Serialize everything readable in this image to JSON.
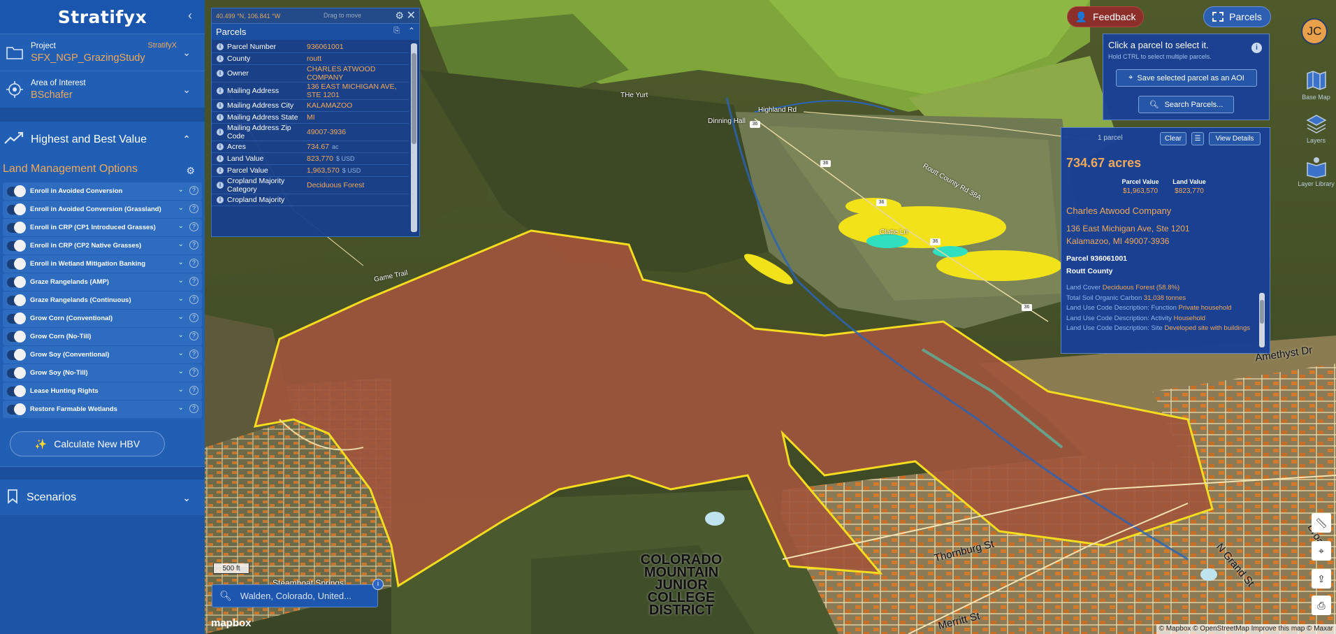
{
  "app": {
    "logo": "Stratifyx"
  },
  "project": {
    "label": "Project",
    "value": "SFX_NGP_GrazingStudy",
    "org": "StratifyX"
  },
  "aoi": {
    "label": "Area of Interest",
    "value": "BSchafer"
  },
  "hbv": {
    "title": "Highest and Best Value",
    "subtitle": "Land Management Options",
    "options": [
      "Enroll in Avoided Conversion",
      "Enroll in Avoided Conversion (Grassland)",
      "Enroll in CRP (CP1 Introduced Grasses)",
      "Enroll in CRP (CP2 Native Grasses)",
      "Enroll in Wetland Mitigation Banking",
      "Graze Rangelands (AMP)",
      "Graze Rangelands (Continuous)",
      "Grow Corn (Conventional)",
      "Grow Corn (No-Till)",
      "Grow Soy (Conventional)",
      "Grow Soy (No-Till)",
      "Lease Hunting Rights",
      "Restore Farmable Wetlands"
    ],
    "calc_label": "Calculate New HBV"
  },
  "scenarios": {
    "label": "Scenarios"
  },
  "parcel_panel": {
    "coords": "40.499 °N, 106.841 °W",
    "drag": "Drag to move",
    "title": "Parcels",
    "rows": [
      {
        "k": "Parcel Number",
        "v": "936061001",
        "u": ""
      },
      {
        "k": "County",
        "v": "routt",
        "u": ""
      },
      {
        "k": "Owner",
        "v": "CHARLES ATWOOD COMPANY",
        "u": ""
      },
      {
        "k": "Mailing Address",
        "v": "136 EAST MICHIGAN AVE, STE 1201",
        "u": ""
      },
      {
        "k": "Mailing Address City",
        "v": "KALAMAZOO",
        "u": ""
      },
      {
        "k": "Mailing Address State",
        "v": "MI",
        "u": ""
      },
      {
        "k": "Mailing Address Zip Code",
        "v": "49007-3936",
        "u": ""
      },
      {
        "k": "Acres",
        "v": "734.67",
        "u": "ac"
      },
      {
        "k": "Land Value",
        "v": "823,770",
        "u": "$ USD"
      },
      {
        "k": "Parcel Value",
        "v": "1,963,570",
        "u": "$ USD"
      },
      {
        "k": "Cropland Majority Category",
        "v": "Deciduous Forest",
        "u": ""
      },
      {
        "k": "Cropland Majority",
        "v": "",
        "u": ""
      }
    ]
  },
  "top": {
    "feedback": "Feedback",
    "parcels": "Parcels",
    "avatar": "JC"
  },
  "select_panel": {
    "title": "Click a parcel to select it.",
    "hint": "Hold CTRL to select multiple parcels.",
    "save_btn": "Save selected parcel as an AOI",
    "search_btn": "Search Parcels..."
  },
  "details": {
    "count": "1 parcel",
    "clear": "Clear",
    "view": "View Details",
    "acres": "734.67 acres",
    "parcel_value_label": "Parcel Value",
    "parcel_value": "$1,963,570",
    "land_value_label": "Land Value",
    "land_value": "$823,770",
    "owner": "Charles Atwood Company",
    "addr1": "136 East Michigan Ave, Ste 1201",
    "addr2": "Kalamazoo, MI 49007-3936",
    "parcel_num": "Parcel 936061001",
    "county": "Routt County",
    "attrs": [
      {
        "k": "Land Cover",
        "v": "Deciduous Forest (58.8%)"
      },
      {
        "k": "Total Soil Organic Carbon",
        "v": "31,038 tonnes"
      },
      {
        "k": "Land Use Code Description: Function",
        "v": "Private household"
      },
      {
        "k": "Land Use Code Description: Activity",
        "v": "Household"
      },
      {
        "k": "Land Use Code Description: Site",
        "v": "Developed site with buildings"
      }
    ]
  },
  "tools": [
    {
      "label": "Base Map",
      "icon": "map-icon"
    },
    {
      "label": "Layers",
      "icon": "layers-icon"
    },
    {
      "label": "Layer Library",
      "icon": "library-icon"
    }
  ],
  "map": {
    "scale": "500 ft",
    "search_placeholder": "Walden, Colorado, United...",
    "logo": "mapbox",
    "attribution": "© Mapbox © OpenStreetMap Improve this map © Maxar",
    "labels": {
      "yurt": "THe Yurt",
      "highland": "Highland Rd",
      "dinning": "Dinning Hall",
      "routt": "Routt County Rd 38A",
      "clatte": "Clatte Ln",
      "game": "Game Trail",
      "steamboat": "Steamboat Springs",
      "college": "COLORADO MOUNTAIN JUNIOR COLLEGE DISTRICT",
      "thornburg": "Thornburg St",
      "merritt": "Merritt St",
      "ngrand": "N Grand St",
      "amethyst": "Amethyst Dr",
      "broad": "Broad"
    },
    "shield": "36",
    "colors": {
      "parcel_fill": "#a0553c",
      "parcel_border": "#f5dc1e",
      "sidebar": "#1f5bb0",
      "accent": "#f0a95b"
    }
  }
}
